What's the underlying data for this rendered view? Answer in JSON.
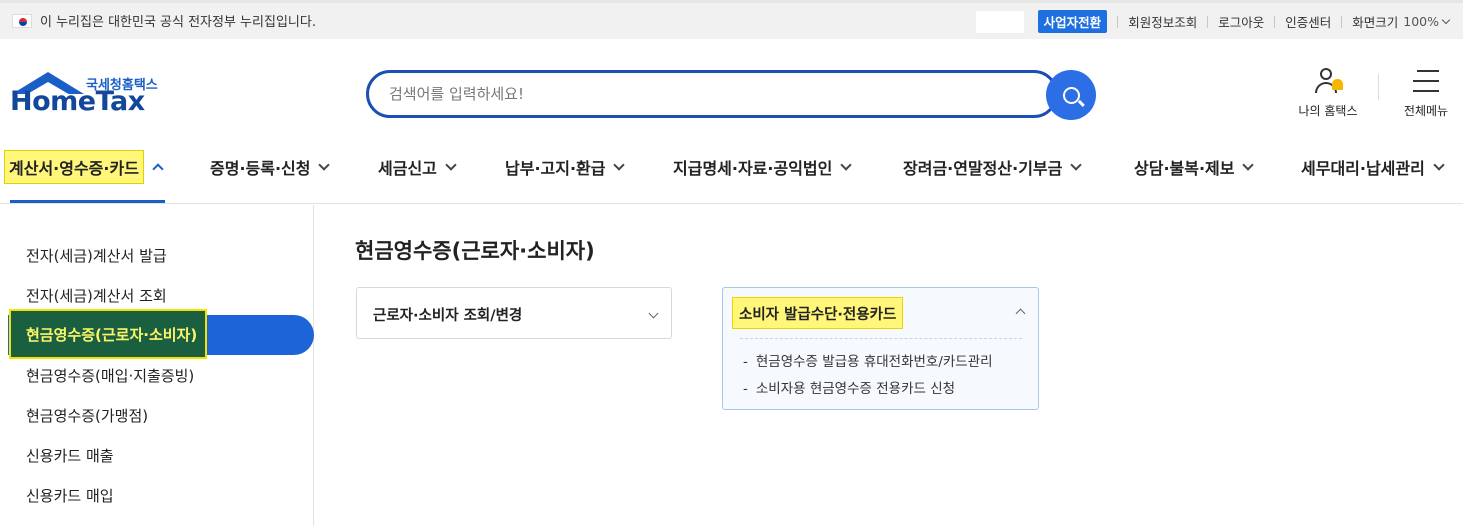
{
  "gov_bar": {
    "notice": "이 누리집은 대한민국 공식 전자정부 누리집입니다.",
    "biz_switch": "사업자전환",
    "member_info": "회원정보조회",
    "logout": "로그아웃",
    "cert_center": "인증센터",
    "screen_size_label": "화면크기",
    "screen_size_value": "100%"
  },
  "logo": {
    "sub": "국세청홈택스",
    "main": "HomeTax"
  },
  "search": {
    "placeholder": "검색어를 입력하세요!"
  },
  "header_right": {
    "my_hometax": "나의 홈택스",
    "all_menu": "전체메뉴"
  },
  "gnb": {
    "items": [
      {
        "label": "계산서·영수증·카드",
        "active": true
      },
      {
        "label": "증명·등록·신청"
      },
      {
        "label": "세금신고"
      },
      {
        "label": "납부·고지·환급"
      },
      {
        "label": "지급명세·자료·공익법인"
      },
      {
        "label": "장려금·연말정산·기부금"
      },
      {
        "label": "상담·불복·제보"
      },
      {
        "label": "세무대리·납세관리"
      }
    ]
  },
  "sidebar": {
    "items": [
      {
        "label": "전자(세금)계산서 발급"
      },
      {
        "label": "전자(세금)계산서 조회"
      },
      {
        "label": "현금영수증(근로자·소비자)",
        "active": true
      },
      {
        "label": "현금영수증(매입·지출증빙)"
      },
      {
        "label": "현금영수증(가맹점)"
      },
      {
        "label": "신용카드 매출"
      },
      {
        "label": "신용카드 매입"
      }
    ]
  },
  "content": {
    "title": "현금영수증(근로자·소비자)",
    "accordion1": {
      "label": "근로자·소비자 조회/변경"
    },
    "accordion2": {
      "label": "소비자 발급수단·전용카드",
      "links": [
        {
          "dash": "-",
          "label": "현금영수증 발급용 휴대전화번호/카드관리"
        },
        {
          "dash": "-",
          "label": "소비자용 현금영수증 전용카드 신청"
        }
      ]
    }
  },
  "colors": {
    "brand_blue": "#1a5fc7",
    "search_btn": "#2b6ee6",
    "highlight_yellow": "#fff67a",
    "active_side_bg": "#1a6040"
  }
}
